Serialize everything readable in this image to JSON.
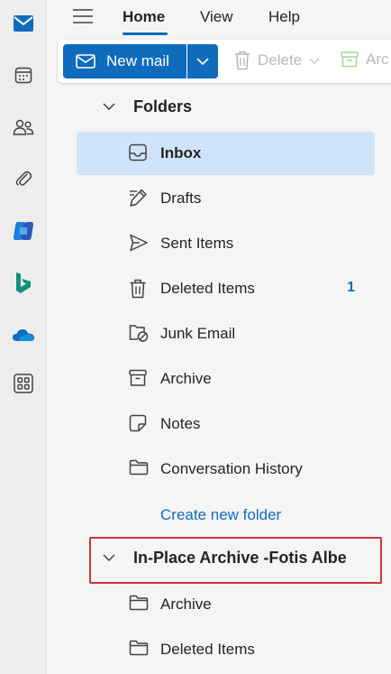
{
  "rail": {
    "items": [
      {
        "name": "mail-icon",
        "color": "#0f6cbd"
      },
      {
        "name": "calendar-icon"
      },
      {
        "name": "people-icon"
      },
      {
        "name": "attachment-icon"
      },
      {
        "name": "copilot-icon"
      },
      {
        "name": "bing-icon"
      },
      {
        "name": "onedrive-icon"
      },
      {
        "name": "apps-icon"
      }
    ]
  },
  "topnav": {
    "tabs": [
      {
        "label": "Home",
        "active": true
      },
      {
        "label": "View"
      },
      {
        "label": "Help"
      }
    ]
  },
  "ribbon": {
    "new_mail_label": "New mail",
    "delete_label": "Delete",
    "archive_label": "Arc"
  },
  "folders": {
    "section_title": "Folders",
    "items": [
      {
        "label": "Inbox",
        "icon": "inbox-icon",
        "selected": true
      },
      {
        "label": "Drafts",
        "icon": "drafts-icon"
      },
      {
        "label": "Sent Items",
        "icon": "sent-icon"
      },
      {
        "label": "Deleted Items",
        "icon": "trash-icon",
        "count": "1"
      },
      {
        "label": "Junk Email",
        "icon": "junk-icon"
      },
      {
        "label": "Archive",
        "icon": "archive-icon"
      },
      {
        "label": "Notes",
        "icon": "notes-icon"
      },
      {
        "label": "Conversation History",
        "icon": "folder-icon"
      }
    ],
    "create_new_folder": "Create new folder"
  },
  "archive_mailbox": {
    "title": "In-Place Archive -Fotis Albe",
    "highlight_color": "#d13438",
    "items": [
      {
        "label": "Archive",
        "icon": "folder-icon"
      },
      {
        "label": "Deleted Items",
        "icon": "folder-icon"
      }
    ]
  },
  "colors": {
    "accent": "#0f6cbd",
    "selected_bg": "#cfe4fa",
    "pane_bg": "#f5f5f5"
  }
}
